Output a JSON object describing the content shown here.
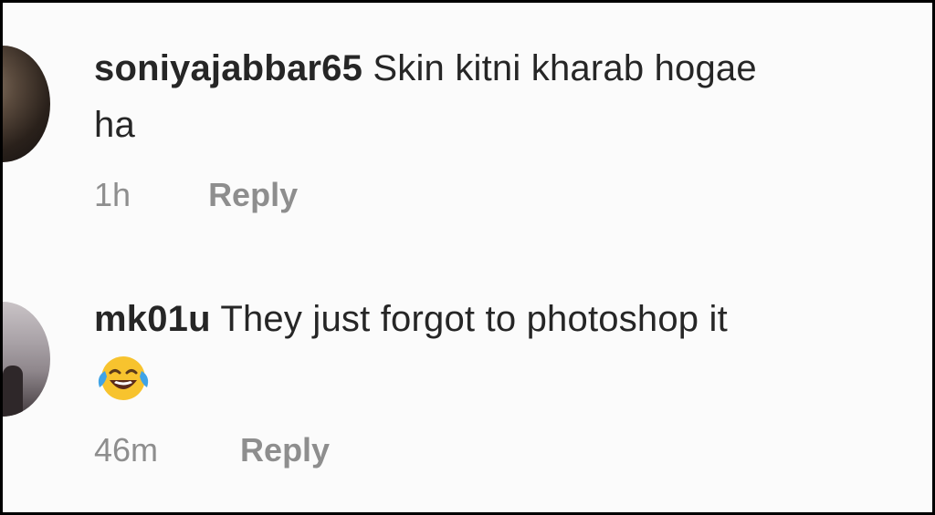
{
  "comments": [
    {
      "username": "soniyajabbar65",
      "text_line1": "Skin kitni kharab hogae",
      "text_line2": "ha",
      "time": "1h",
      "reply_label": "Reply"
    },
    {
      "username": "mk01u",
      "text_line1": "They just forgot to photoshop it",
      "emoji": "face-with-tears-of-joy",
      "time": "46m",
      "reply_label": "Reply"
    }
  ]
}
